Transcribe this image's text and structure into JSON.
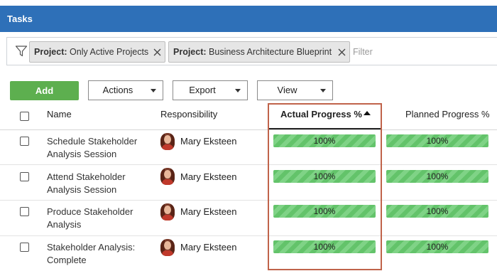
{
  "titlebar": {
    "title": "Tasks"
  },
  "filters": {
    "chips": [
      {
        "key": "Project:",
        "value": "Only Active Projects"
      },
      {
        "key": "Project:",
        "value": "Business Architecture Blueprint"
      }
    ],
    "placeholder": "Filter"
  },
  "toolbar": {
    "add_label": "Add",
    "actions_label": "Actions",
    "export_label": "Export",
    "view_label": "View"
  },
  "columns": {
    "name": "Name",
    "responsibility": "Responsibility",
    "actual_progress": "Actual Progress %",
    "planned_progress": "Planned Progress %"
  },
  "sort": {
    "column": "Actual Progress %",
    "direction": "ascending"
  },
  "rows": [
    {
      "name": "Schedule Stakeholder Analysis Session",
      "responsibility": "Mary Eksteen",
      "actual_progress": "100%",
      "planned_progress": "100%"
    },
    {
      "name": "Attend Stakeholder Analysis Session",
      "responsibility": "Mary Eksteen",
      "actual_progress": "100%",
      "planned_progress": "100%"
    },
    {
      "name": "Produce Stakeholder Analysis",
      "responsibility": "Mary Eksteen",
      "actual_progress": "100%",
      "planned_progress": "100%"
    },
    {
      "name": "Stakeholder Analysis: Complete",
      "responsibility": "Mary Eksteen",
      "actual_progress": "100%",
      "planned_progress": "100%"
    }
  ],
  "colors": {
    "header_bar": "#2e70b8",
    "add_button": "#5daf4f",
    "progress_fill": "#63c36a",
    "highlight_border": "#c0634a"
  },
  "icons": {
    "filter": "filter-funnel-icon",
    "chip_remove": "close-icon",
    "dropdown": "caret-down-icon",
    "sort": "sort-ascending-icon"
  }
}
